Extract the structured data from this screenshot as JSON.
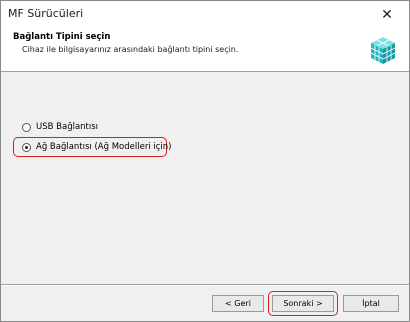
{
  "window": {
    "title": "MF Sürücüleri",
    "close_label": "✕"
  },
  "header": {
    "title": "Bağlantı Tipini seçin",
    "subtitle": "Cihaz ile bilgisayarınız arasındaki bağlantı tipini seçin."
  },
  "options": [
    {
      "label": "USB Bağlantısı",
      "selected": false
    },
    {
      "label": "Ağ Bağlantısı (Ağ Modelleri için)",
      "selected": true
    }
  ],
  "buttons": {
    "back": "< Geri",
    "next": "Sonraki >",
    "cancel": "İptal"
  },
  "colors": {
    "highlight": "#d9201c",
    "icon_teal": "#27c3c9"
  }
}
